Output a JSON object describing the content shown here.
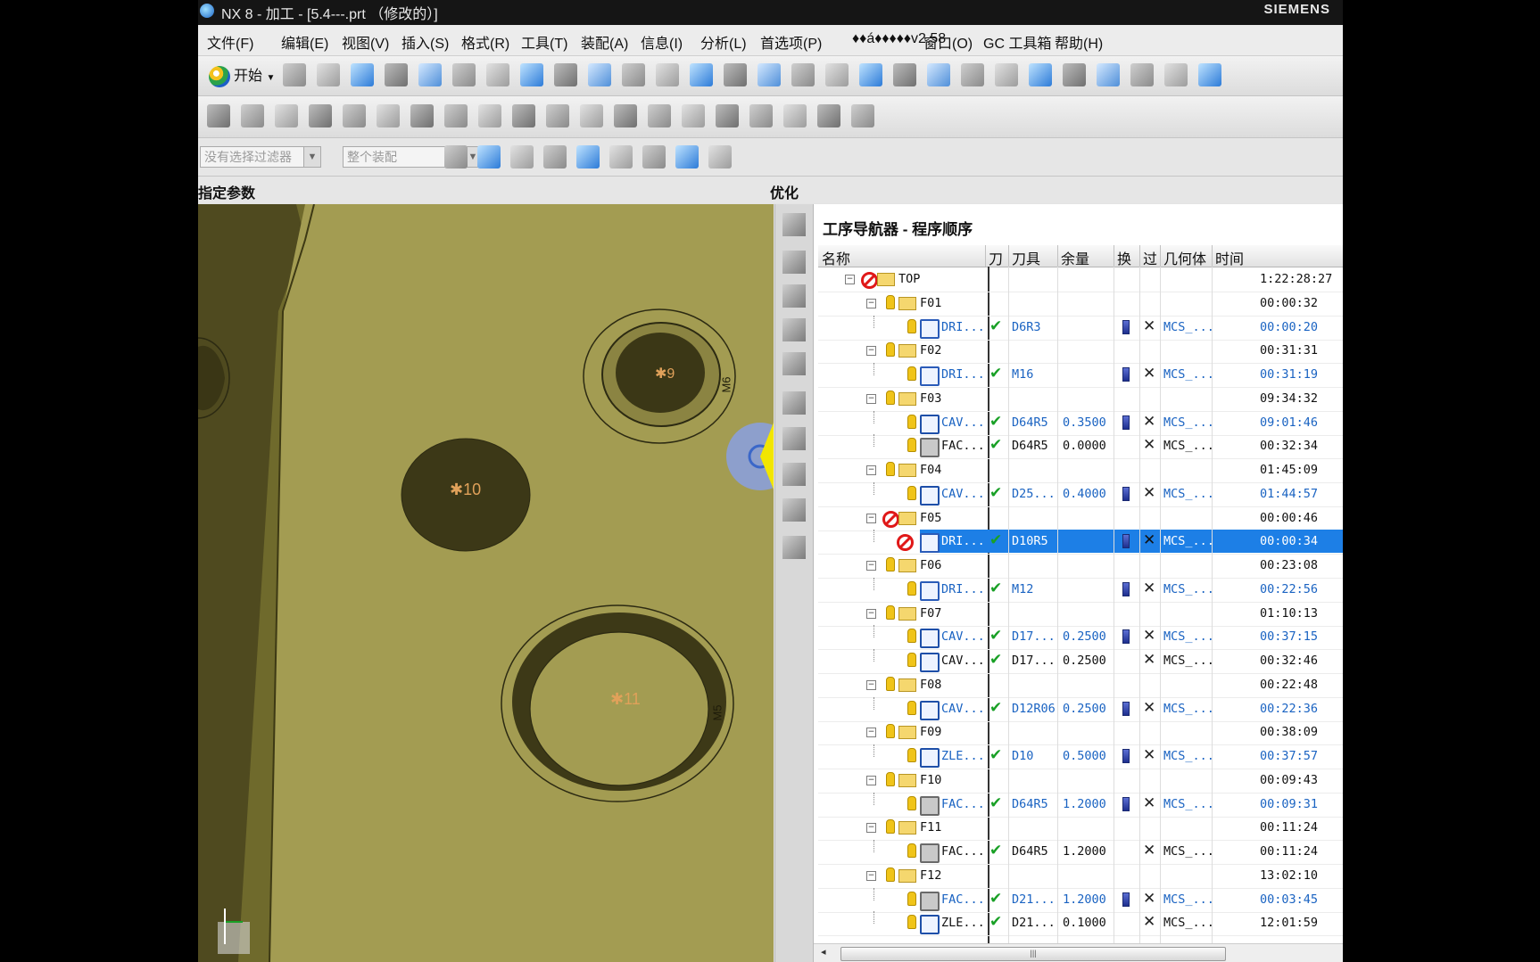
{
  "window": {
    "title": "NX 8 - 加工 - [5.4---.prt （修改的）]",
    "brand": "SIEMENS"
  },
  "menu": [
    "文件(F)",
    "编辑(E)",
    "视图(V)",
    "插入(S)",
    "格式(R)",
    "工具(T)",
    "装配(A)",
    "信息(I)",
    "分析(L)",
    "首选项(P)",
    "♦♦á♦♦♦♦♦v2.58",
    "窗口(O)",
    "GC 工具箱",
    "帮助(H)"
  ],
  "toolbar": {
    "start_label": "开始",
    "filter_placeholder": "没有选择过滤器",
    "assembly_placeholder": "整个装配"
  },
  "panels": {
    "left_title": "指定参数",
    "right_title": "优化"
  },
  "viewport": {
    "labels": [
      "9",
      "10",
      "11"
    ],
    "edge_marks": [
      "M6",
      "M5"
    ]
  },
  "navigator": {
    "title": "工序导航器 - 程序顺序",
    "columns": [
      "名称",
      "刀",
      "刀具",
      "余量",
      "换",
      "过",
      "几何体",
      "时间"
    ],
    "rows": [
      {
        "level": 0,
        "name": "TOP",
        "type": "root",
        "time": "1:22:28:27",
        "blocked": true
      },
      {
        "level": 1,
        "name": "F01",
        "type": "group",
        "time": "00:00:32"
      },
      {
        "level": 2,
        "name": "DRI...",
        "type": "drill",
        "ok": true,
        "tool": "D6R3",
        "stock": "",
        "chg": true,
        "cut": true,
        "geom": "MCS_...",
        "time": "00:00:20",
        "blue": true
      },
      {
        "level": 1,
        "name": "F02",
        "type": "group",
        "time": "00:31:31"
      },
      {
        "level": 2,
        "name": "DRI...",
        "type": "drill",
        "ok": true,
        "tool": "M16",
        "stock": "",
        "chg": true,
        "cut": true,
        "geom": "MCS_...",
        "time": "00:31:19",
        "blue": true
      },
      {
        "level": 1,
        "name": "F03",
        "type": "group",
        "time": "09:34:32"
      },
      {
        "level": 2,
        "name": "CAV...",
        "type": "cav",
        "ok": true,
        "tool": "D64R5",
        "stock": "0.3500",
        "chg": true,
        "cut": true,
        "geom": "MCS_...",
        "time": "09:01:46",
        "blue": true
      },
      {
        "level": 2,
        "name": "FAC...",
        "type": "fac",
        "ok": true,
        "tool": "D64R5",
        "stock": "0.0000",
        "chg": false,
        "cut": true,
        "geom": "MCS_...",
        "time": "00:32:34",
        "blue": false
      },
      {
        "level": 1,
        "name": "F04",
        "type": "group",
        "time": "01:45:09"
      },
      {
        "level": 2,
        "name": "CAV...",
        "type": "cav",
        "ok": true,
        "tool": "D25...",
        "stock": "0.4000",
        "chg": true,
        "cut": true,
        "geom": "MCS_...",
        "time": "01:44:57",
        "blue": true
      },
      {
        "level": 1,
        "name": "F05",
        "type": "group",
        "time": "00:00:46",
        "blocked": true
      },
      {
        "level": 2,
        "name": "DRI...",
        "type": "drill",
        "ok": true,
        "tool": "D10R5",
        "stock": "",
        "chg": true,
        "cut": true,
        "geom": "MCS_...",
        "time": "00:00:34",
        "blue": true,
        "selected": true,
        "blocked": true
      },
      {
        "level": 1,
        "name": "F06",
        "type": "group",
        "time": "00:23:08"
      },
      {
        "level": 2,
        "name": "DRI...",
        "type": "drill",
        "ok": true,
        "tool": "M12",
        "stock": "",
        "chg": true,
        "cut": true,
        "geom": "MCS_...",
        "time": "00:22:56",
        "blue": true
      },
      {
        "level": 1,
        "name": "F07",
        "type": "group",
        "time": "01:10:13"
      },
      {
        "level": 2,
        "name": "CAV...",
        "type": "cav",
        "ok": true,
        "tool": "D17...",
        "stock": "0.2500",
        "chg": true,
        "cut": true,
        "geom": "MCS_...",
        "time": "00:37:15",
        "blue": true
      },
      {
        "level": 2,
        "name": "CAV...",
        "type": "cav",
        "ok": true,
        "tool": "D17...",
        "stock": "0.2500",
        "chg": false,
        "cut": true,
        "geom": "MCS_...",
        "time": "00:32:46",
        "blue": false
      },
      {
        "level": 1,
        "name": "F08",
        "type": "group",
        "time": "00:22:48"
      },
      {
        "level": 2,
        "name": "CAV...",
        "type": "cav",
        "ok": true,
        "tool": "D12R06",
        "stock": "0.2500",
        "chg": true,
        "cut": true,
        "geom": "MCS_...",
        "time": "00:22:36",
        "blue": true
      },
      {
        "level": 1,
        "name": "F09",
        "type": "group",
        "time": "00:38:09"
      },
      {
        "level": 2,
        "name": "ZLE...",
        "type": "zle",
        "ok": true,
        "tool": "D10",
        "stock": "0.5000",
        "chg": true,
        "cut": true,
        "geom": "MCS_...",
        "time": "00:37:57",
        "blue": true
      },
      {
        "level": 1,
        "name": "F10",
        "type": "group",
        "time": "00:09:43"
      },
      {
        "level": 2,
        "name": "FAC...",
        "type": "fac",
        "ok": true,
        "tool": "D64R5",
        "stock": "1.2000",
        "chg": true,
        "cut": true,
        "geom": "MCS_...",
        "time": "00:09:31",
        "blue": true
      },
      {
        "level": 1,
        "name": "F11",
        "type": "group",
        "time": "00:11:24"
      },
      {
        "level": 2,
        "name": "FAC...",
        "type": "fac",
        "ok": true,
        "tool": "D64R5",
        "stock": "1.2000",
        "chg": false,
        "cut": true,
        "geom": "MCS_...",
        "time": "00:11:24",
        "blue": false
      },
      {
        "level": 1,
        "name": "F12",
        "type": "group",
        "time": "13:02:10"
      },
      {
        "level": 2,
        "name": "FAC...",
        "type": "fac",
        "ok": true,
        "tool": "D21...",
        "stock": "1.2000",
        "chg": true,
        "cut": true,
        "geom": "MCS_...",
        "time": "00:03:45",
        "blue": true
      },
      {
        "level": 2,
        "name": "ZLE...",
        "type": "zle",
        "ok": true,
        "tool": "D21...",
        "stock": "0.1000",
        "chg": false,
        "cut": true,
        "geom": "MCS_...",
        "time": "12:01:59",
        "blue": false
      }
    ]
  },
  "colors": {
    "part_surface": "#706a2d",
    "selection": "#1d7fe6",
    "time_blue": "#1a63c2",
    "blocked_red": "#e01818"
  }
}
